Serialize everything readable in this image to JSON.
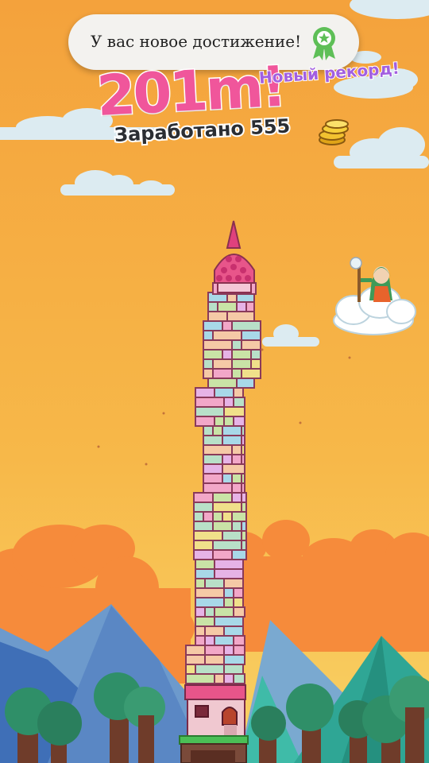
{
  "notification": {
    "text": "У вас новое достижение!",
    "icon": "achievement-ribbon-icon"
  },
  "score": {
    "height_text": "201m!",
    "record_text": "Новый рекорд!",
    "earned_text": "Заработано 555",
    "coin_icon": "gold-coins-icon"
  },
  "colors": {
    "sky_top": "#f4a23c",
    "sky_bottom": "#f8cf60",
    "score_pink": "#f0569b",
    "record_purple": "#a25fe0",
    "achievement_green": "#5ebf57"
  }
}
